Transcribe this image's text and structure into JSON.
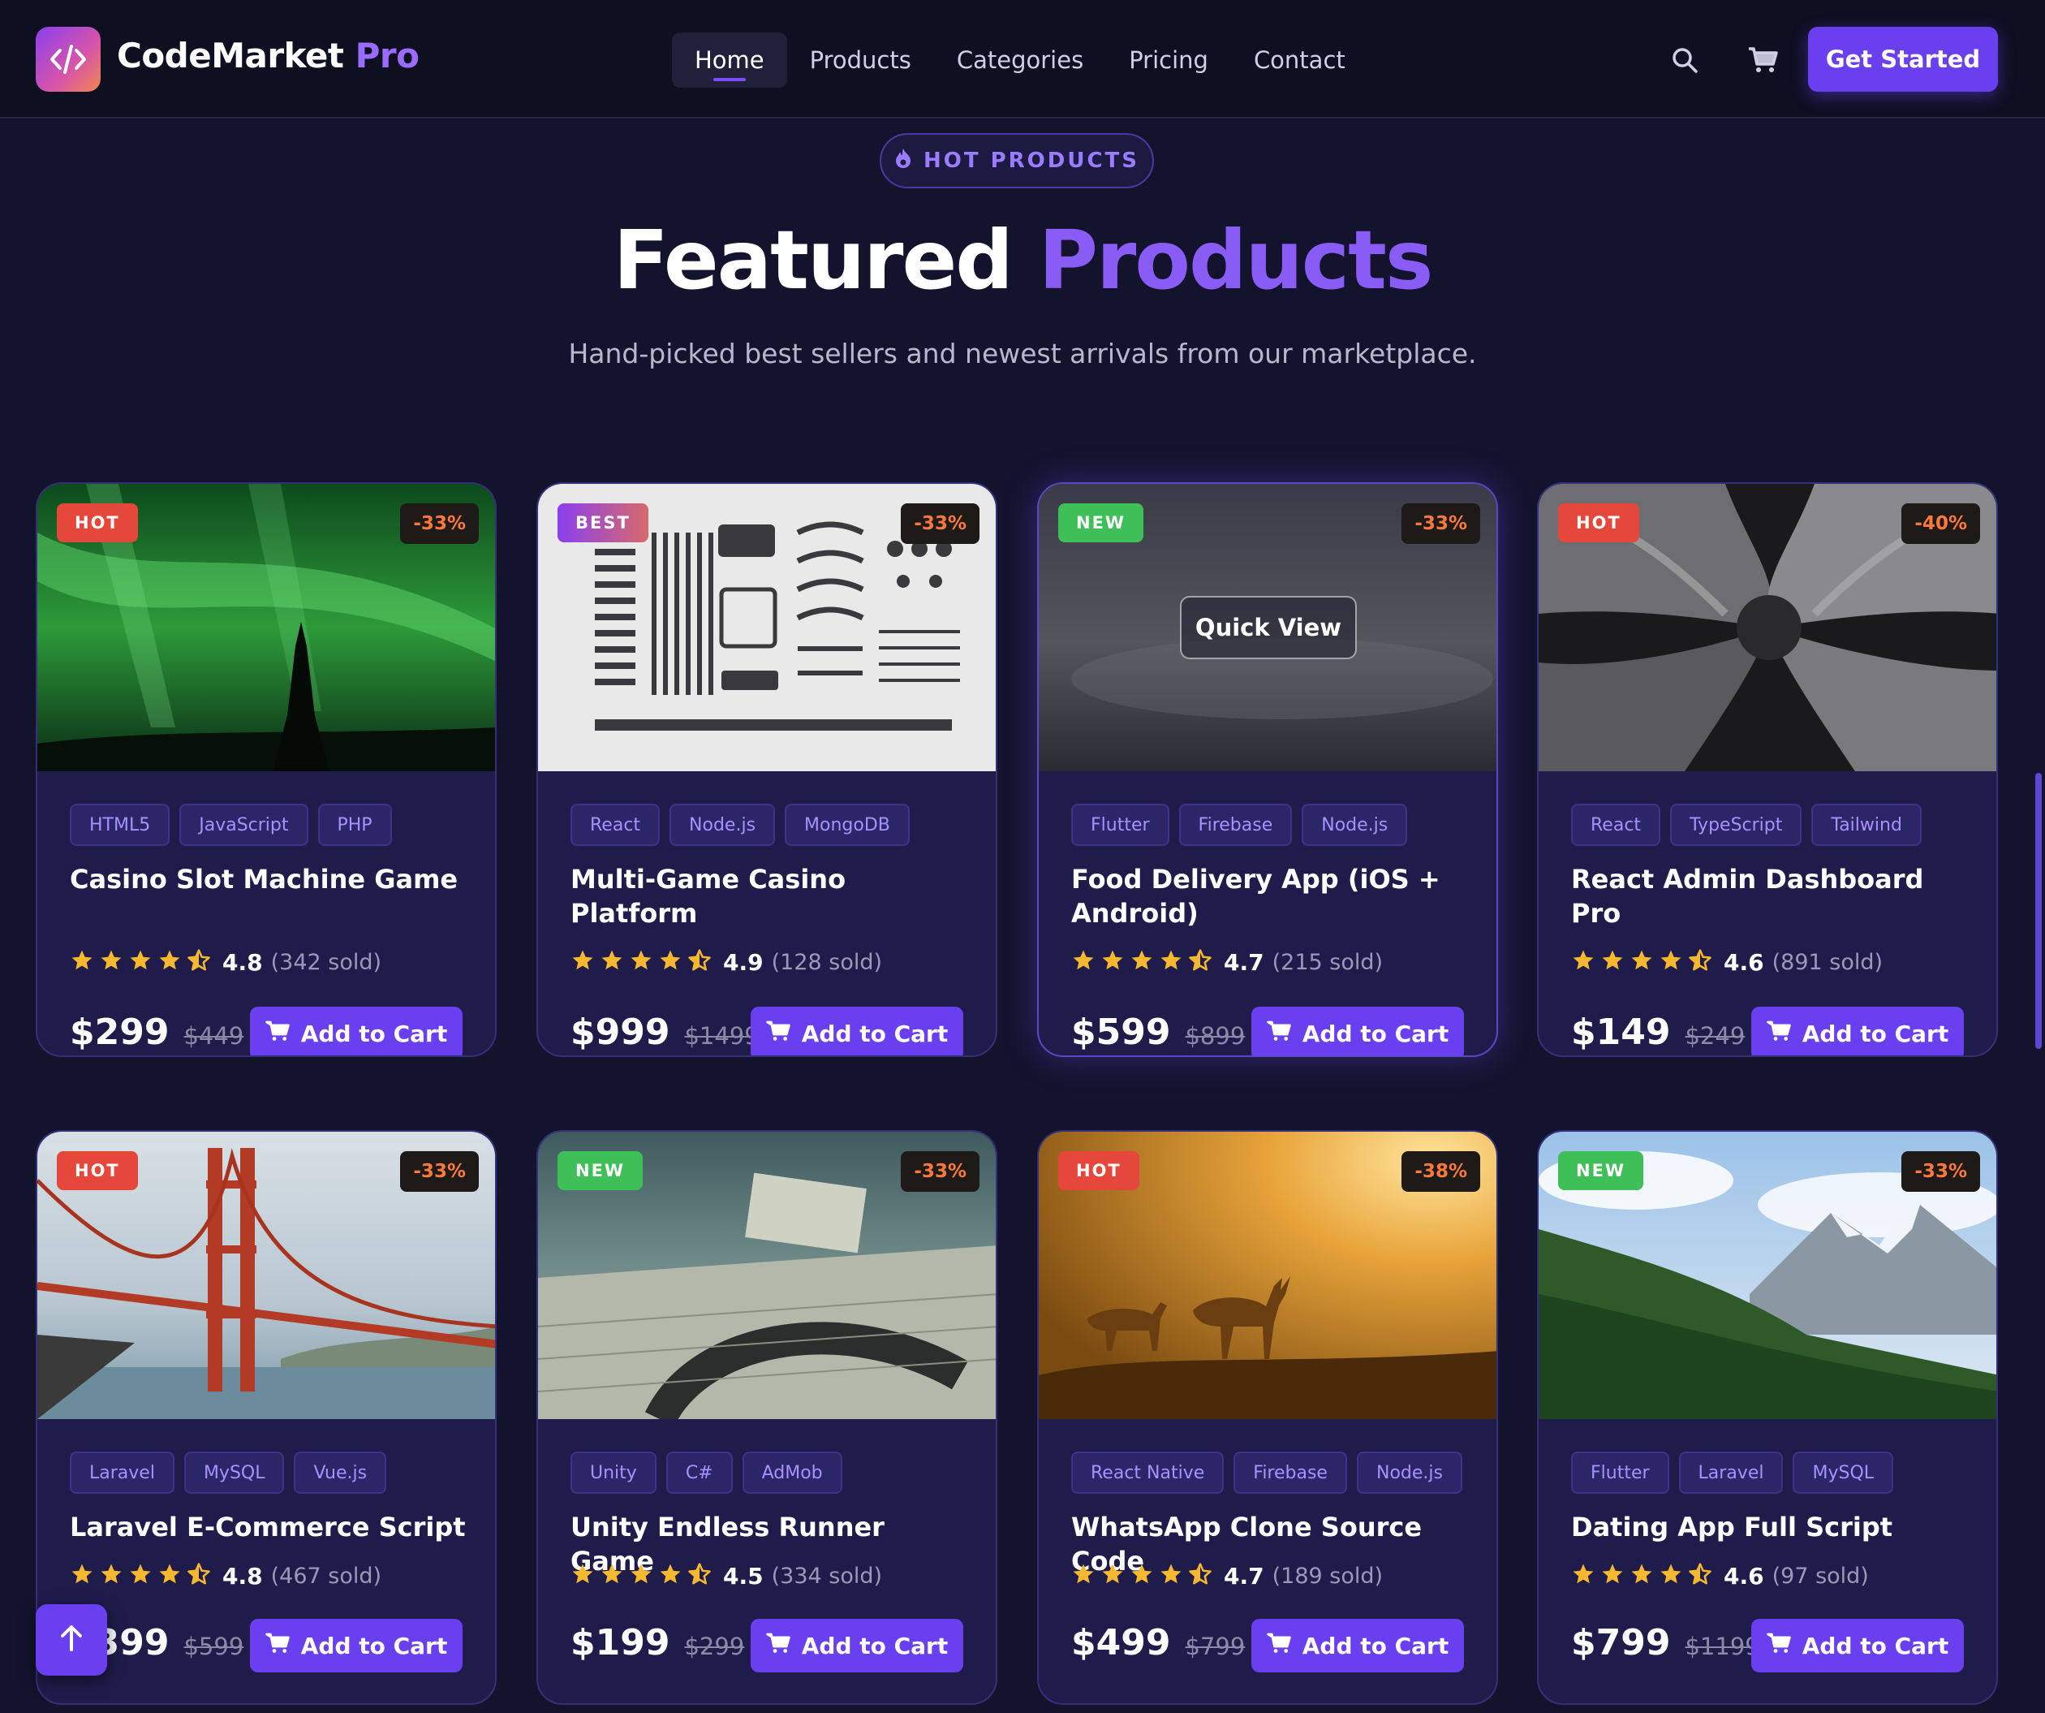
{
  "header": {
    "brand_part1": "CodeMarket",
    "brand_part2": "Pro",
    "nav": [
      "Home",
      "Products",
      "Categories",
      "Pricing",
      "Contact"
    ],
    "active_nav": "Home",
    "cta_label": "Get Started",
    "icons": [
      "code-icon",
      "search-icon",
      "cart-icon"
    ]
  },
  "hero": {
    "pill_label": "HOT PRODUCTS",
    "title_part1": "Featured",
    "title_part2": "Products",
    "subtitle": "Hand-picked best sellers and newest arrivals from our marketplace."
  },
  "colors": {
    "background": "#13132e",
    "accent": "#6a3ff0",
    "accent_text": "#8a5cf6",
    "hot": "#e5473a",
    "new": "#3fbf58",
    "star": "#f5b82e",
    "discount": "#ff7a3a"
  },
  "products": [
    {
      "badge": "HOT",
      "discount": "-33%",
      "tags": [
        "HTML5",
        "JavaScript",
        "PHP"
      ],
      "name": "Casino Slot Machine Game",
      "rating": "4.8",
      "rating_value": 4.8,
      "sold": "(342 sold)",
      "price": "$299",
      "old_price": "$449",
      "button": "Add to Cart",
      "image": "aurora-photo"
    },
    {
      "badge": "BEST",
      "discount": "-33%",
      "tags": [
        "React",
        "Node.js",
        "MongoDB"
      ],
      "name": "Multi-Game Casino Platform",
      "rating": "4.9",
      "rating_value": 4.9,
      "sold": "(128 sold)",
      "price": "$999",
      "old_price": "$1499",
      "button": "Add to Cart",
      "image": "disassembled-typewriter-photo"
    },
    {
      "badge": "NEW",
      "discount": "-33%",
      "tags": [
        "Flutter",
        "Firebase",
        "Node.js"
      ],
      "name": "Food Delivery App (iOS + Android)",
      "rating": "4.7",
      "rating_value": 4.7,
      "sold": "(215 sold)",
      "price": "$599",
      "old_price": "$899",
      "button": "Add to Cart",
      "image": "blurred-photo",
      "quick_view": "Quick View"
    },
    {
      "badge": "HOT",
      "discount": "-40%",
      "tags": [
        "React",
        "TypeScript",
        "Tailwind"
      ],
      "name": "React Admin Dashboard Pro",
      "rating": "4.6",
      "rating_value": 4.6,
      "sold": "(891 sold)",
      "price": "$149",
      "old_price": "$249",
      "button": "Add to Cart",
      "image": "arches-photo"
    },
    {
      "badge": "HOT",
      "discount": "-33%",
      "tags": [
        "Laravel",
        "MySQL",
        "Vue.js"
      ],
      "name": "Laravel E-Commerce Script",
      "rating": "4.8",
      "rating_value": 4.8,
      "sold": "(467 sold)",
      "price": "$399",
      "old_price": "$599",
      "button": "Add to Cart",
      "image": "golden-gate-photo"
    },
    {
      "badge": "NEW",
      "discount": "-33%",
      "tags": [
        "Unity",
        "C#",
        "AdMob"
      ],
      "name": "Unity Endless Runner Game",
      "rating": "4.5",
      "rating_value": 4.5,
      "sold": "(334 sold)",
      "price": "$199",
      "old_price": "$299",
      "button": "Add to Cart",
      "image": "map-desk-photo"
    },
    {
      "badge": "HOT",
      "discount": "-38%",
      "tags": [
        "React Native",
        "Firebase",
        "Node.js"
      ],
      "name": "WhatsApp Clone Source Code",
      "rating": "4.7",
      "rating_value": 4.7,
      "sold": "(189 sold)",
      "price": "$499",
      "old_price": "$799",
      "button": "Add to Cart",
      "image": "deer-sunrise-photo"
    },
    {
      "badge": "NEW",
      "discount": "-33%",
      "tags": [
        "Flutter",
        "Laravel",
        "MySQL"
      ],
      "name": "Dating App Full Script",
      "rating": "4.6",
      "rating_value": 4.6,
      "sold": "(97 sold)",
      "price": "$799",
      "old_price": "$1199",
      "button": "Add to Cart",
      "image": "mountain-forest-photo"
    }
  ]
}
